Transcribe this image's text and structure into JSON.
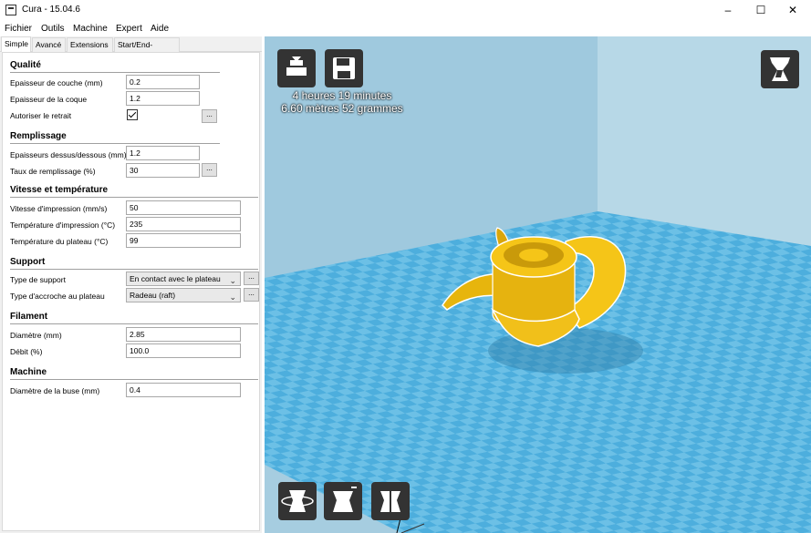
{
  "window": {
    "title": "Cura - 15.04.6",
    "controls": [
      "–",
      "☐",
      "✕"
    ]
  },
  "menu": [
    "Fichier",
    "Outils",
    "Machine",
    "Expert",
    "Aide"
  ],
  "tabs": [
    "Simple",
    "Avancé",
    "Extensions",
    "Start/End-GCode"
  ],
  "sections": {
    "quality": {
      "title": "Qualité",
      "layer_height_label": "Epaisseur de couche (mm)",
      "layer_height": "0.2",
      "shell_label": "Epaisseur de la coque",
      "shell": "1.2",
      "retraction_label": "Autoriser le retrait"
    },
    "fill": {
      "title": "Remplissage",
      "top_bottom_label": "Epaisseurs dessus/dessous (mm)",
      "top_bottom": "1.2",
      "density_label": "Taux de remplissage (%)",
      "density": "30"
    },
    "speed": {
      "title": "Vitesse et température",
      "print_speed_label": "Vitesse d'impression (mm/s)",
      "print_speed": "50",
      "print_temp_label": "Température d'impression (°C)",
      "print_temp": "235",
      "bed_temp_label": "Température du plateau (°C)",
      "bed_temp": "99"
    },
    "support": {
      "title": "Support",
      "type_label": "Type de support",
      "type": "En contact avec le plateau",
      "adhesion_label": "Type d'accroche au plateau",
      "adhesion": "Radeau (raft)"
    },
    "filament": {
      "title": "Filament",
      "diameter_label": "Diamètre (mm)",
      "diameter": "2.85",
      "flow_label": "Débit (%)",
      "flow": "100.0"
    },
    "machine": {
      "title": "Machine",
      "nozzle_label": "Diamètre de la buse (mm)",
      "nozzle": "0.4"
    }
  },
  "dots": "...",
  "viewport": {
    "print_time": "4 heures 19 minutes",
    "material": "6.60 mètres 52 grammes"
  },
  "colors": {
    "model": "#f5c518",
    "plate": "#5fb8e0",
    "plate_dark": "#3a9fd0",
    "wall": "#a9cfe0"
  }
}
